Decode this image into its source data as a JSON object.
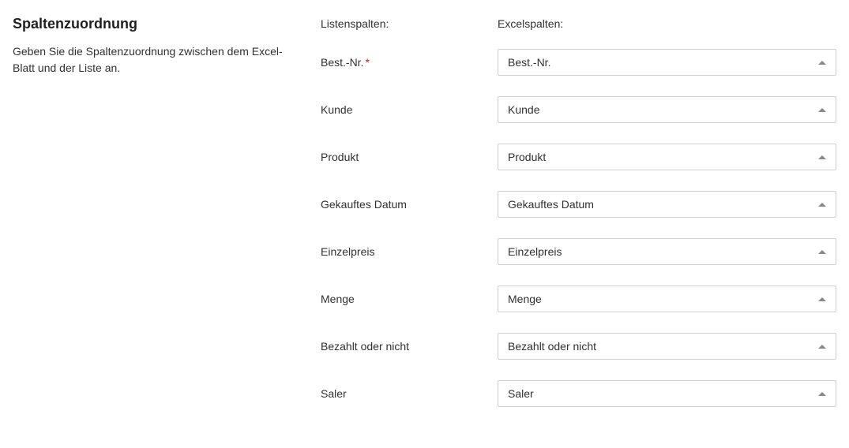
{
  "section": {
    "title": "Spaltenzuordnung",
    "description": "Geben Sie die Spaltenzuordnung zwischen dem Excel-Blatt und der Liste an."
  },
  "headers": {
    "listColumns": "Listenspalten:",
    "excelColumns": "Excelspalten:"
  },
  "mappings": [
    {
      "label": "Best.-Nr.",
      "required": true,
      "value": "Best.-Nr."
    },
    {
      "label": "Kunde",
      "required": false,
      "value": "Kunde"
    },
    {
      "label": "Produkt",
      "required": false,
      "value": "Produkt"
    },
    {
      "label": "Gekauftes Datum",
      "required": false,
      "value": "Gekauftes Datum"
    },
    {
      "label": "Einzelpreis",
      "required": false,
      "value": "Einzelpreis"
    },
    {
      "label": "Menge",
      "required": false,
      "value": "Menge"
    },
    {
      "label": "Bezahlt oder nicht",
      "required": false,
      "value": "Bezahlt oder nicht"
    },
    {
      "label": "Saler",
      "required": false,
      "value": "Saler"
    }
  ],
  "requiredMarker": "*"
}
